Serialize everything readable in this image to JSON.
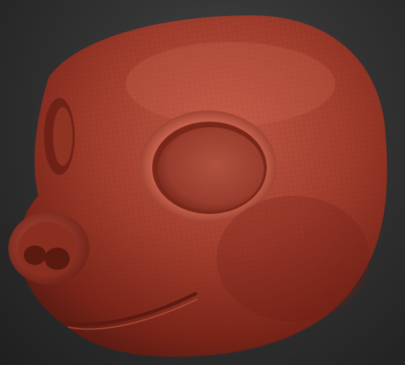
{
  "viewport": {
    "background": "#2f2f2f",
    "model": "sculpted-animal-head",
    "material_color": "#9a3b2b",
    "wireframe_overlay": true
  }
}
